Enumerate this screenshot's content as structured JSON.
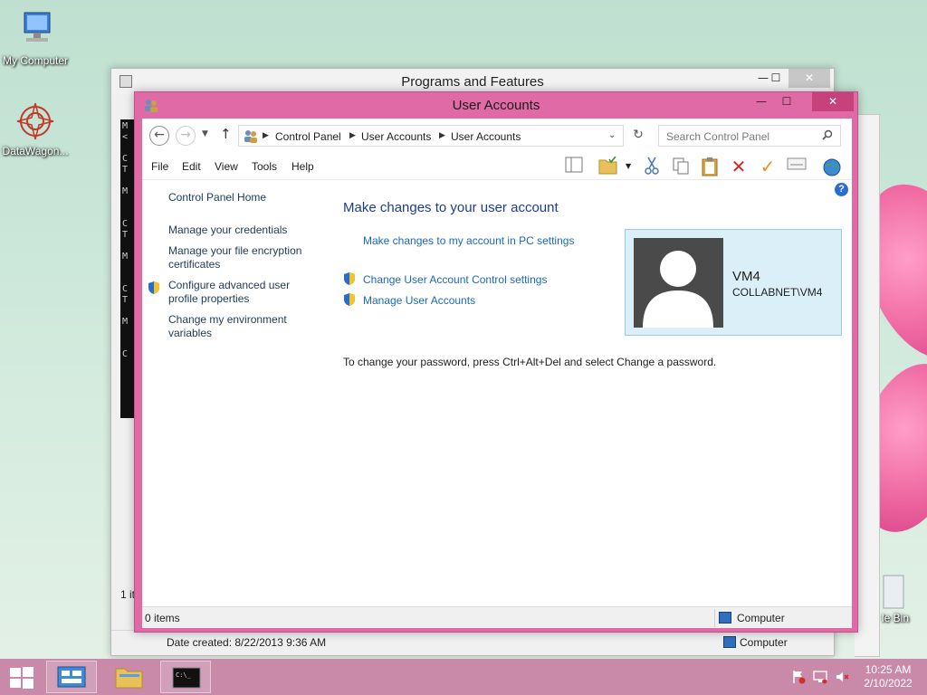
{
  "desktop": {
    "icons": [
      {
        "label": "My Computer"
      },
      {
        "label": "DataWagon..."
      },
      {
        "label": "le Bin"
      }
    ]
  },
  "back_window": {
    "title": "Programs and Features",
    "left_status": "1 it",
    "date_created": "Date created: 8/22/2013 9:36 AM",
    "computer_label": "Computer",
    "console_text": "M\n<\n\nC\nT\n\nM\n\n\nC\nT\n\nM\n\n\nC\nT\n\nM\n\n\nC"
  },
  "main_window": {
    "title": "User Accounts",
    "address": {
      "crumbs": [
        "Control Panel",
        "User Accounts",
        "User Accounts"
      ]
    },
    "search": {
      "placeholder": "Search Control Panel"
    },
    "menu": [
      "File",
      "Edit",
      "View",
      "Tools",
      "Help"
    ],
    "left_tasks": {
      "home": "Control Panel Home",
      "credentials": "Manage your credentials",
      "encryption": "Manage your file encryption certificates",
      "advanced": "Configure advanced user profile properties",
      "environment": "Change my environment variables"
    },
    "content": {
      "heading": "Make changes to your user account",
      "pc_settings_link": "Make changes to my account in PC settings",
      "uac_link": "Change User Account Control settings",
      "manage_link": "Manage User Accounts",
      "password_note": "To change your password, press Ctrl+Alt+Del and select Change a password."
    },
    "user": {
      "name": "VM4",
      "domain": "COLLABNET\\VM4"
    },
    "status": {
      "items": "0 items",
      "computer": "Computer"
    }
  },
  "taskbar": {
    "time": "10:25 AM",
    "date": "2/10/2022"
  },
  "colors": {
    "window_frame": "#df6aa6",
    "taskbar": "#c98aa9",
    "link": "#1a68b8",
    "heading": "#1e3d8f"
  }
}
